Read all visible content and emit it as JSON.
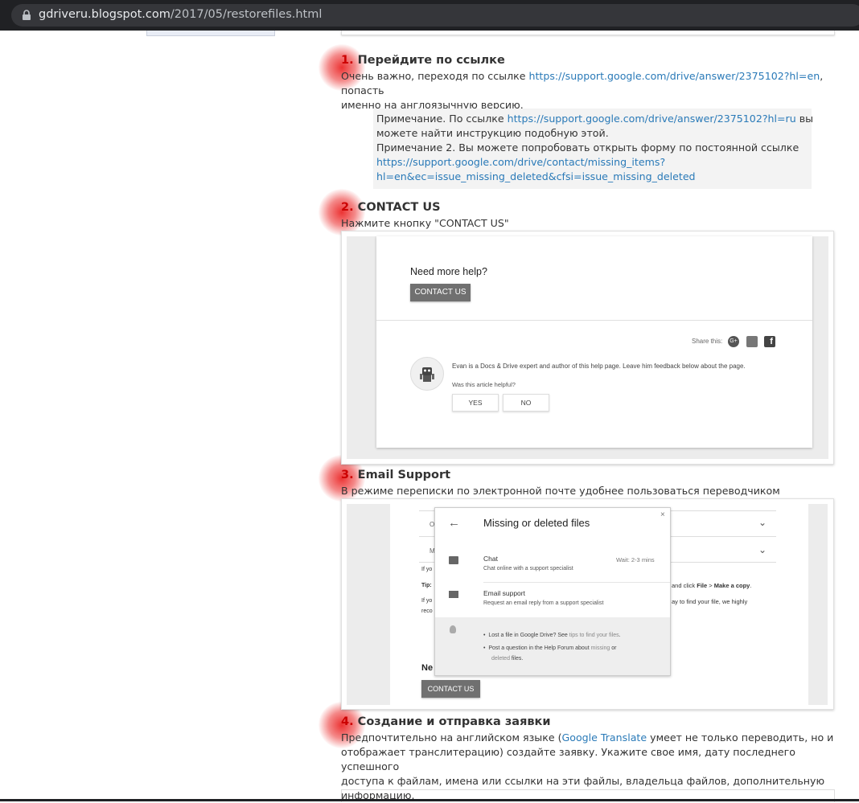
{
  "browser": {
    "url_host": "gdriveru.blogspot.com",
    "url_path": "/2017/05/restorefiles.html"
  },
  "steps": [
    {
      "num": "1.",
      "title": "Перейдите по ссылке",
      "text_before": "Очень важно, переходя по ссылке ",
      "link": "https://support.google.com/drive/answer/2375102?hl=en",
      "text_after": ", попасть",
      "text_line2": "именно на англоязычную версию."
    },
    {
      "num": "2.",
      "title": "CONTACT US",
      "text": "Нажмите кнопку \"CONTACT US\""
    },
    {
      "num": "3.",
      "title": "Email Support",
      "text": "В режиме переписки по электронной почте удобнее пользоваться переводчиком"
    },
    {
      "num": "4.",
      "title": "Создание и отправка заявки",
      "text_before": "Предпочтительно на английском языке (",
      "link": "Google Translate",
      "text_after": " умеет не только переводить, но и",
      "line2": "отображает транслитерацию) создайте заявку. Укажите свое имя, дату последнего успешного",
      "line3": "доступа к файлам, имена или ссылки на эти файлы, владельца файлов, дополнительную",
      "line4": "информацию."
    }
  ],
  "note": {
    "line1_before": "Примечание. По ссылке ",
    "line1_link": "https://support.google.com/drive/answer/2375102?hl=ru",
    "line1_after": " вы",
    "line2": "можете найти инструкцию подобную этой.",
    "line3": "Примечание 2. Вы можете попробовать открыть форму по постоянной ссылке",
    "link2_line1": "https://support.google.com/drive/contact/missing_items?",
    "link2_line2": "hl=en&ec=issue_missing_deleted&cfsi=issue_missing_deleted"
  },
  "shot1": {
    "need_help": "Need more help?",
    "contact_us": "CONTACT US",
    "share_this": "Share this:",
    "author_text": "Evan is a Docs & Drive expert and author of this help page. Leave him feedback below about the page.",
    "helpful": "Was this article helpful?",
    "yes": "YES",
    "no": "NO"
  },
  "shot2": {
    "dialog_title": "Missing or deleted files",
    "close": "×",
    "chat_title": "Chat",
    "chat_wait": "Wait: 2-3 mins",
    "chat_sub": "Chat online with a support specialist",
    "email_title": "Email support",
    "email_sub": "Request an email reply from a support specialist",
    "tip1_a": "Lost a file in Google Drive? See ",
    "tip1_link": "tips to find your files",
    "tip1_b": ".",
    "tip2_a": "Post a question in the Help Forum about ",
    "tip2_link1": "missing",
    "tip2_b": " or",
    "tip2_link2": "deleted",
    "tip2_c": " files.",
    "bg_o": "O",
    "bg_m": "M",
    "bg_ifyo": "If yo",
    "bg_tip": "Tip:",
    "bg_ifyo2": "If yo",
    "bg_reco": "reco",
    "bg_right1_a": "and click ",
    "bg_right1_file": "File",
    "bg_right1_b": " > ",
    "bg_right1_copy": "Make a copy",
    "bg_right1_c": ".",
    "bg_right2": "ay to find your file, we highly",
    "bg_ne": "Ne",
    "contact_us": "CONTACT US"
  },
  "colors": {
    "link": "#2a7ab8",
    "step_number": "#cc0000",
    "marker": "#eb2828",
    "note_bg": "#f3f3f3",
    "button_gray": "#707070"
  }
}
